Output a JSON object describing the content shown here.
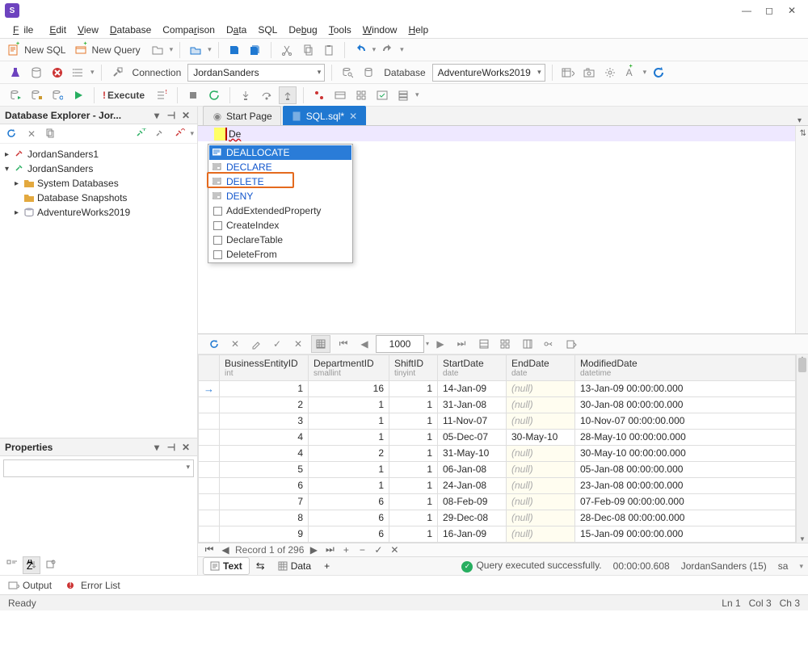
{
  "menu": {
    "file": "File",
    "edit": "Edit",
    "view": "View",
    "database": "Database",
    "comparison": "Comparison",
    "data": "Data",
    "sql": "SQL",
    "debug": "Debug",
    "tools": "Tools",
    "window": "Window",
    "help": "Help"
  },
  "toolbar1": {
    "new_sql": "New SQL",
    "new_query": "New Query"
  },
  "toolbar2": {
    "connection_label": "Connection",
    "connection_value": "JordanSanders",
    "database_label": "Database",
    "database_value": "AdventureWorks2019"
  },
  "toolbar3": {
    "execute": "Execute"
  },
  "explorer": {
    "title": "Database Explorer - Jor...",
    "nodes": {
      "conn1": "JordanSanders1",
      "conn2": "JordanSanders",
      "sysdb": "System Databases",
      "snapshots": "Database Snapshots",
      "db": "AdventureWorks2019"
    }
  },
  "properties": {
    "title": "Properties"
  },
  "tabs": {
    "start": "Start Page",
    "sql": "SQL.sql*"
  },
  "editor": {
    "typed": "De"
  },
  "autocomplete": {
    "items": [
      {
        "text": "DEALLOCATE",
        "kind": "kw"
      },
      {
        "text": "DECLARE",
        "kind": "kw"
      },
      {
        "text": "DELETE",
        "kind": "kw"
      },
      {
        "text": "DENY",
        "kind": "kw"
      },
      {
        "text": "AddExtendedProperty",
        "kind": "snip"
      },
      {
        "text": "CreateIndex",
        "kind": "snip"
      },
      {
        "text": "DeclareTable",
        "kind": "snip"
      },
      {
        "text": "DeleteFrom",
        "kind": "snip"
      }
    ]
  },
  "grid": {
    "page_size": "1000",
    "columns": [
      {
        "name": "BusinessEntityID",
        "type": "int"
      },
      {
        "name": "DepartmentID",
        "type": "smallint"
      },
      {
        "name": "ShiftID",
        "type": "tinyint"
      },
      {
        "name": "StartDate",
        "type": "date"
      },
      {
        "name": "EndDate",
        "type": "date"
      },
      {
        "name": "ModifiedDate",
        "type": "datetime"
      }
    ],
    "rows": [
      {
        "be": 1,
        "dep": 16,
        "sh": 1,
        "start": "14-Jan-09",
        "end": null,
        "mod": "13-Jan-09 00:00:00.000"
      },
      {
        "be": 2,
        "dep": 1,
        "sh": 1,
        "start": "31-Jan-08",
        "end": null,
        "mod": "30-Jan-08 00:00:00.000"
      },
      {
        "be": 3,
        "dep": 1,
        "sh": 1,
        "start": "11-Nov-07",
        "end": null,
        "mod": "10-Nov-07 00:00:00.000"
      },
      {
        "be": 4,
        "dep": 1,
        "sh": 1,
        "start": "05-Dec-07",
        "end": "30-May-10",
        "mod": "28-May-10 00:00:00.000"
      },
      {
        "be": 4,
        "dep": 2,
        "sh": 1,
        "start": "31-May-10",
        "end": null,
        "mod": "30-May-10 00:00:00.000"
      },
      {
        "be": 5,
        "dep": 1,
        "sh": 1,
        "start": "06-Jan-08",
        "end": null,
        "mod": "05-Jan-08 00:00:00.000"
      },
      {
        "be": 6,
        "dep": 1,
        "sh": 1,
        "start": "24-Jan-08",
        "end": null,
        "mod": "23-Jan-08 00:00:00.000"
      },
      {
        "be": 7,
        "dep": 6,
        "sh": 1,
        "start": "08-Feb-09",
        "end": null,
        "mod": "07-Feb-09 00:00:00.000"
      },
      {
        "be": 8,
        "dep": 6,
        "sh": 1,
        "start": "29-Dec-08",
        "end": null,
        "mod": "28-Dec-08 00:00:00.000"
      },
      {
        "be": 9,
        "dep": 6,
        "sh": 1,
        "start": "16-Jan-09",
        "end": null,
        "mod": "15-Jan-09 00:00:00.000"
      }
    ],
    "nav": "Record 1 of 296",
    "null_text": "(null)"
  },
  "result": {
    "text_tab": "Text",
    "data_tab": "Data",
    "status": "Query executed successfully.",
    "elapsed": "00:00:00.608",
    "conn": "JordanSanders (15)",
    "user": "sa"
  },
  "bottom": {
    "output": "Output",
    "errors": "Error List"
  },
  "status": {
    "ready": "Ready",
    "ln": "Ln 1",
    "col": "Col 3",
    "ch": "Ch 3"
  }
}
